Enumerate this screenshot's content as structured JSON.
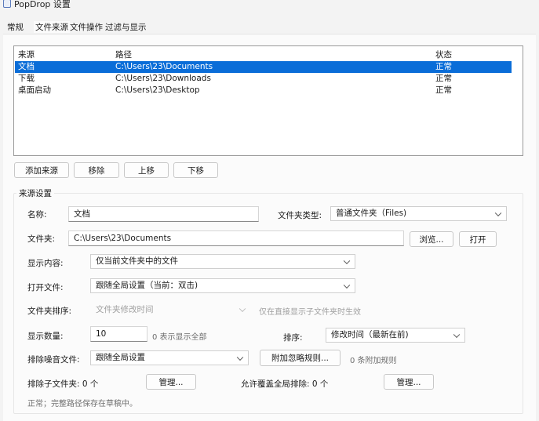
{
  "window": {
    "title": "PopDrop 设置"
  },
  "tabs": [
    "常规",
    "文件来源",
    "文件操作",
    "过滤与显示"
  ],
  "source_list": {
    "columns": [
      "来源",
      "路径",
      "状态"
    ],
    "rows": [
      [
        "文档",
        "C:\\Users\\23\\Documents",
        "正常"
      ],
      [
        "下载",
        "C:\\Users\\23\\Downloads",
        "正常"
      ],
      [
        "桌面启动",
        "C:\\Users\\23\\Desktop",
        "正常"
      ]
    ]
  },
  "list_buttons": {
    "add": "添加来源",
    "remove": "移除",
    "up": "上移",
    "down": "下移"
  },
  "settings": {
    "group_title": "来源设置",
    "name_label": "名称:",
    "name_value": "文档",
    "folder_type_label": "文件夹类型:",
    "folder_type_value": "普通文件夹（Files)",
    "folder_label": "文件夹:",
    "folder_value": "C:\\Users\\23\\Documents",
    "browse": "浏览...",
    "open": "打开",
    "display_label": "显示内容:",
    "display_value": "仅当前文件夹中的文件",
    "open_file_label": "打开文件:",
    "open_file_value": "跟随全局设置（当前：双击)",
    "folder_sort_label": "文件夹排序:",
    "folder_sort_value": "文件夹修改时间",
    "folder_sort_hint": "仅在直接显示子文件夹时生效",
    "count_label": "显示数量:",
    "count_value": "10",
    "count_hint": "0 表示显示全部",
    "sort_label": "排序:",
    "sort_value": "修改时间（最新在前)",
    "noise_label": "排除噪音文件:",
    "noise_value": "跟随全局设置",
    "rules_button": "附加忽略规则...",
    "rules_hint": "0 条附加规则",
    "exclude_sub_label": "排除子文件夹: 0 个",
    "manage1": "管理...",
    "allow_label": "允许覆盖全局排除: 0 个",
    "manage2": "管理...",
    "status": "正常；完整路径保存在草稿中。"
  },
  "colors": {
    "selection": "#0a6dd8",
    "window_bg": "#f3f3f3"
  }
}
